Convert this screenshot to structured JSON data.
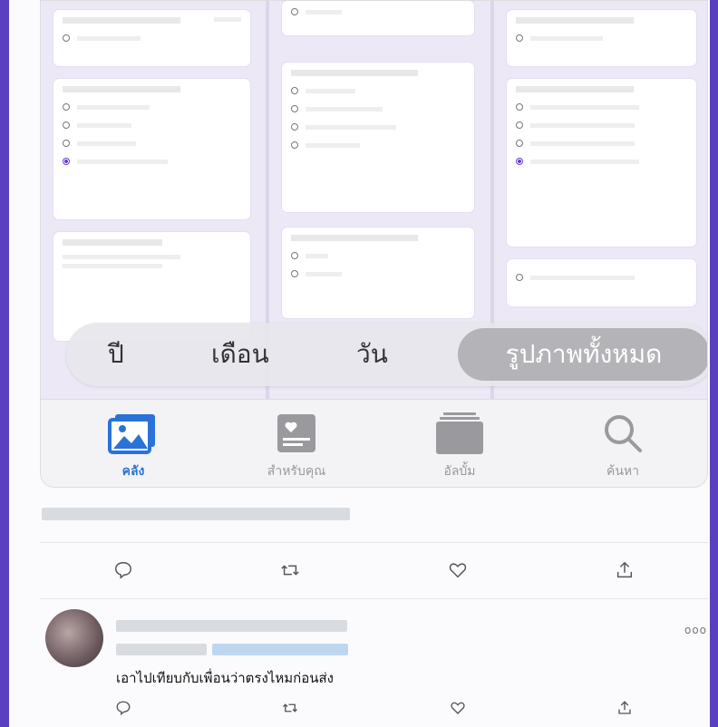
{
  "photos_app": {
    "segments": [
      "ปี",
      "เดือน",
      "วัน"
    ],
    "segment_selected": "รูปภาพทั้งหมด",
    "tabs": [
      {
        "label": "คลัง",
        "icon": "photo-library-icon",
        "active": true
      },
      {
        "label": "สำหรับคุณ",
        "icon": "for-you-icon",
        "active": false
      },
      {
        "label": "อัลบั้ม",
        "icon": "albums-icon",
        "active": false
      },
      {
        "label": "ค้นหา",
        "icon": "search-icon",
        "active": false
      }
    ]
  },
  "tweet2": {
    "text": "เอาไปเทียบกับเพื่อนว่าตรงไหมก่อนส่ง",
    "more": "ooo"
  },
  "colors": {
    "accent": "#2a72d8",
    "frame": "#5a3fbf",
    "form_accent": "#6a3fd0"
  }
}
